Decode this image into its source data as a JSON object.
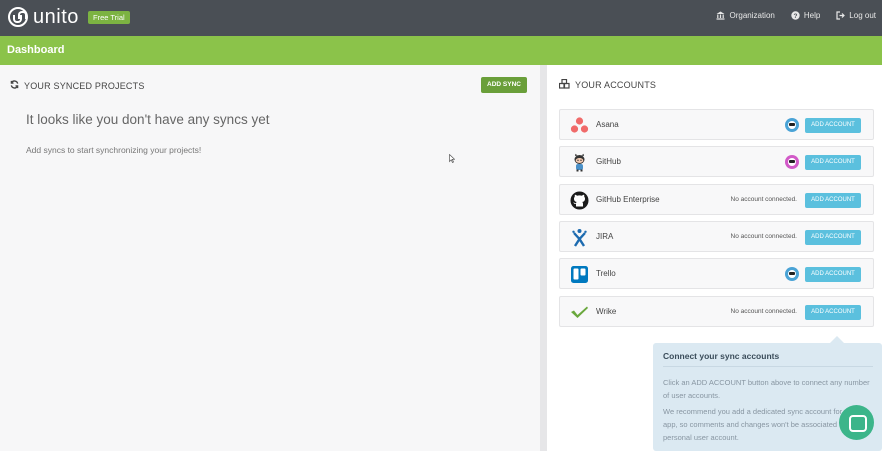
{
  "header": {
    "logo_text": "unito",
    "trial_badge": "Free Trial",
    "nav": {
      "organization": "Organization",
      "help": "Help",
      "logout": "Log out"
    }
  },
  "subheader": {
    "title": "Dashboard"
  },
  "synced_projects": {
    "heading": "YOUR SYNCED PROJECTS",
    "add_button": "ADD SYNC",
    "empty_title": "It looks like you don't have any syncs yet",
    "empty_subtitle": "Add syncs to start synchronizing your projects!"
  },
  "accounts": {
    "heading": "YOUR ACCOUNTS",
    "add_button_label": "ADD ACCOUNT",
    "no_account_text": "No account connected.",
    "items": [
      {
        "name": "Asana",
        "icon": "asana-icon",
        "connected": true,
        "avatar_color": "#4aa3d6"
      },
      {
        "name": "GitHub",
        "icon": "github-octocat-icon",
        "connected": true,
        "avatar_color": "#d25ac8"
      },
      {
        "name": "GitHub Enterprise",
        "icon": "github-icon",
        "connected": false
      },
      {
        "name": "JIRA",
        "icon": "jira-icon",
        "connected": false
      },
      {
        "name": "Trello",
        "icon": "trello-icon",
        "connected": true,
        "avatar_color": "#4aa3d6"
      },
      {
        "name": "Wrike",
        "icon": "wrike-icon",
        "connected": false
      }
    ]
  },
  "tooltip": {
    "title": "Connect your sync accounts",
    "paragraph1": "Click an ADD ACCOUNT button above to connect any number of user accounts.",
    "paragraph2": "We recommend you add a dedicated sync account for each app, so comments and changes won't be associated to your personal user account."
  },
  "colors": {
    "topbar": "#4a4f55",
    "brand_green": "#8bc34a",
    "button_green": "#6a9f3a",
    "button_blue": "#5bc0de",
    "chat": "#3cb58a"
  }
}
